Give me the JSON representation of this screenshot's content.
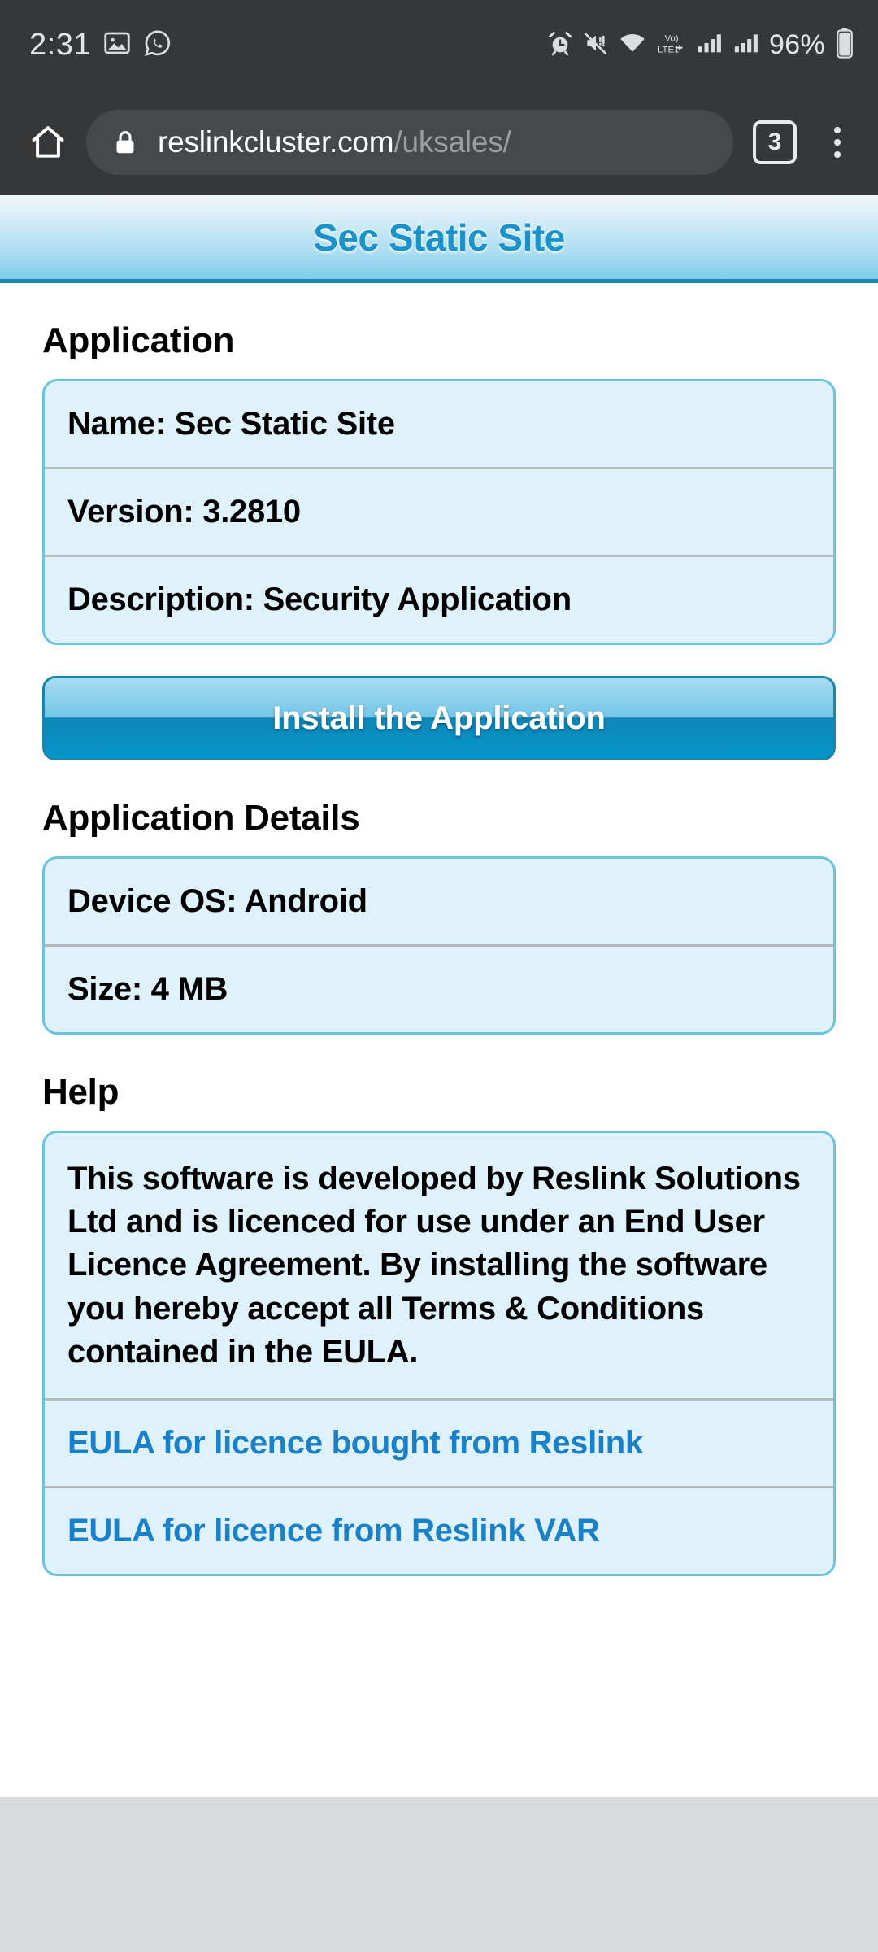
{
  "status_bar": {
    "time": "2:31",
    "battery_percent": "96%",
    "icons": [
      "gallery-icon",
      "whatsapp-icon",
      "alarm-icon",
      "mute-icon",
      "wifi-icon",
      "volte-icon",
      "signal-sim1-icon",
      "signal-sim2-icon",
      "battery-icon"
    ]
  },
  "browser": {
    "home_label": "home-icon",
    "url_domain": "reslinkcluster.com",
    "url_path": "/uksales/",
    "tab_count": "3",
    "menu_label": "more-options-icon"
  },
  "site": {
    "title": "Sec Static Site",
    "accent_color": "#1a93cc",
    "card_bg": "#dff1fa",
    "card_border": "#6cc3e0",
    "link_color": "#1a80c8"
  },
  "sections": {
    "application": {
      "heading": "Application",
      "rows": [
        "Name: Sec Static Site",
        "Version: 3.2810",
        "Description: Security Application"
      ]
    },
    "install": {
      "button_label": "Install the Application"
    },
    "application_details": {
      "heading": "Application Details",
      "rows": [
        "Device OS: Android",
        "Size: 4 MB"
      ]
    },
    "help": {
      "heading": "Help",
      "body": "This software is developed by Reslink Solutions Ltd and is licenced for use under an End User Licence Agreement. By installing the software you hereby accept all Terms & Conditions contained in the EULA.",
      "links": [
        "EULA for licence bought from Reslink",
        "EULA for licence from Reslink VAR"
      ]
    }
  }
}
